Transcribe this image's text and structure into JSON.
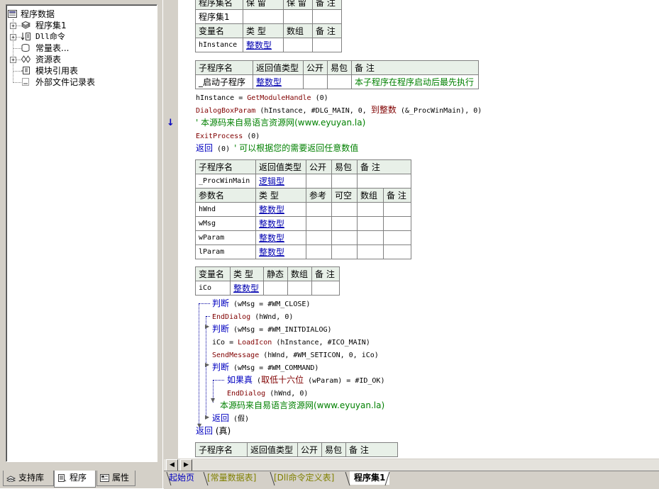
{
  "tree": {
    "root": "程序数据",
    "items": [
      {
        "label": "程序集1",
        "icon": "program-set-icon",
        "expander": "+"
      },
      {
        "label": "Dll命令",
        "icon": "dll-icon",
        "expander": "+"
      },
      {
        "label": "常量表...",
        "icon": "constant-table-icon",
        "expander": ""
      },
      {
        "label": "资源表",
        "icon": "resource-icon",
        "expander": "+"
      },
      {
        "label": "模块引用表",
        "icon": "module-icon",
        "expander": ""
      },
      {
        "label": "外部文件记录表",
        "icon": "file-record-icon",
        "expander": ""
      }
    ]
  },
  "left_tabs": [
    "支持库",
    "程序",
    "属性"
  ],
  "code": {
    "top_table": {
      "hdr1": [
        "程序集名",
        "保 留",
        "保 留",
        "备 注"
      ],
      "row1": [
        "程序集1",
        "",
        "",
        ""
      ],
      "hdr2": [
        "变量名",
        "类 型",
        "数组",
        "备 注"
      ],
      "row2": [
        "hInstance",
        "整数型",
        "",
        ""
      ]
    },
    "sub1": {
      "hdr": [
        "子程序名",
        "返回值类型",
        "公开",
        "易包",
        "备 注"
      ],
      "row": [
        "_启动子程序",
        "整数型",
        "",
        "",
        "本子程序在程序启动后最先执行"
      ]
    },
    "lines1": {
      "l1_a": "hInstance = ",
      "l1_fn": "GetModuleHandle",
      "l1_b": " (0)",
      "l2_fn": "DialogBoxParam",
      "l2_a": " (hInstance, #DLG_MAIN, 0, ",
      "l2_kw": "到整数",
      "l2_b": " (&_ProcWinMain), 0)",
      "l3": "' 本源码来自易语言资源网(www.eyuyan.la)",
      "l4_fn": "ExitProcess",
      "l4_b": " (0)",
      "l5_kw": "返回",
      "l5_a": " (0) ",
      "l5_c": "' 可以根据您的需要返回任意数值"
    },
    "sub2": {
      "hdr": [
        "子程序名",
        "返回值类型",
        "公开",
        "易包",
        "备 注"
      ],
      "row": [
        "_ProcWinMain",
        "逻辑型",
        "",
        "",
        ""
      ],
      "phdr": [
        "参数名",
        "类 型",
        "参考",
        "可空",
        "数组",
        "备 注"
      ],
      "params": [
        [
          "hWnd",
          "整数型"
        ],
        [
          "wMsg",
          "整数型"
        ],
        [
          "wParam",
          "整数型"
        ],
        [
          "lParam",
          "整数型"
        ]
      ]
    },
    "locals": {
      "hdr": [
        "变量名",
        "类 型",
        "静态",
        "数组",
        "备 注"
      ],
      "row": [
        "iCo",
        "整数型",
        "",
        "",
        ""
      ]
    },
    "lines2": {
      "a_kw": "判断",
      "a_b": " (wMsg = #WM_CLOSE)",
      "b_fn": "EndDialog",
      "b_b": " (hWnd, 0)",
      "c_kw": "判断",
      "c_b": " (wMsg = #WM_INITDIALOG)",
      "d_a": "iCo = ",
      "d_fn": "LoadIcon",
      "d_b": " (hInstance, #ICO_MAIN)",
      "e_fn": "SendMessage",
      "e_b": " (hWnd, #WM_SETICON, 0, iCo)",
      "f_kw": "判断",
      "f_b": " (wMsg = #WM_COMMAND)",
      "g_kw": "如果真",
      "g_a": " (",
      "g_kw2": "取低十六位",
      "g_b": " (wParam) = #ID_OK)",
      "h_fn": "EndDialog",
      "h_b": " (hWnd, 0)",
      "i": "本源码来自易语言资源网(www.eyuyan.la)",
      "j_kw": "返回",
      "j_b": " (假)",
      "k_kw": "返回",
      "k_b": " (真)"
    },
    "sub3": {
      "hdr": [
        "子程序名",
        "返回值类型",
        "公开",
        "易包",
        "备 注"
      ]
    }
  },
  "file_tabs": [
    "起始页",
    "[常量数据表]",
    "[Dll命令定义表]",
    "程序集1"
  ],
  "colors": {
    "type": "#0000b0",
    "comment": "#008000",
    "function": "#800000",
    "header_bg": "#e8f0e8"
  }
}
